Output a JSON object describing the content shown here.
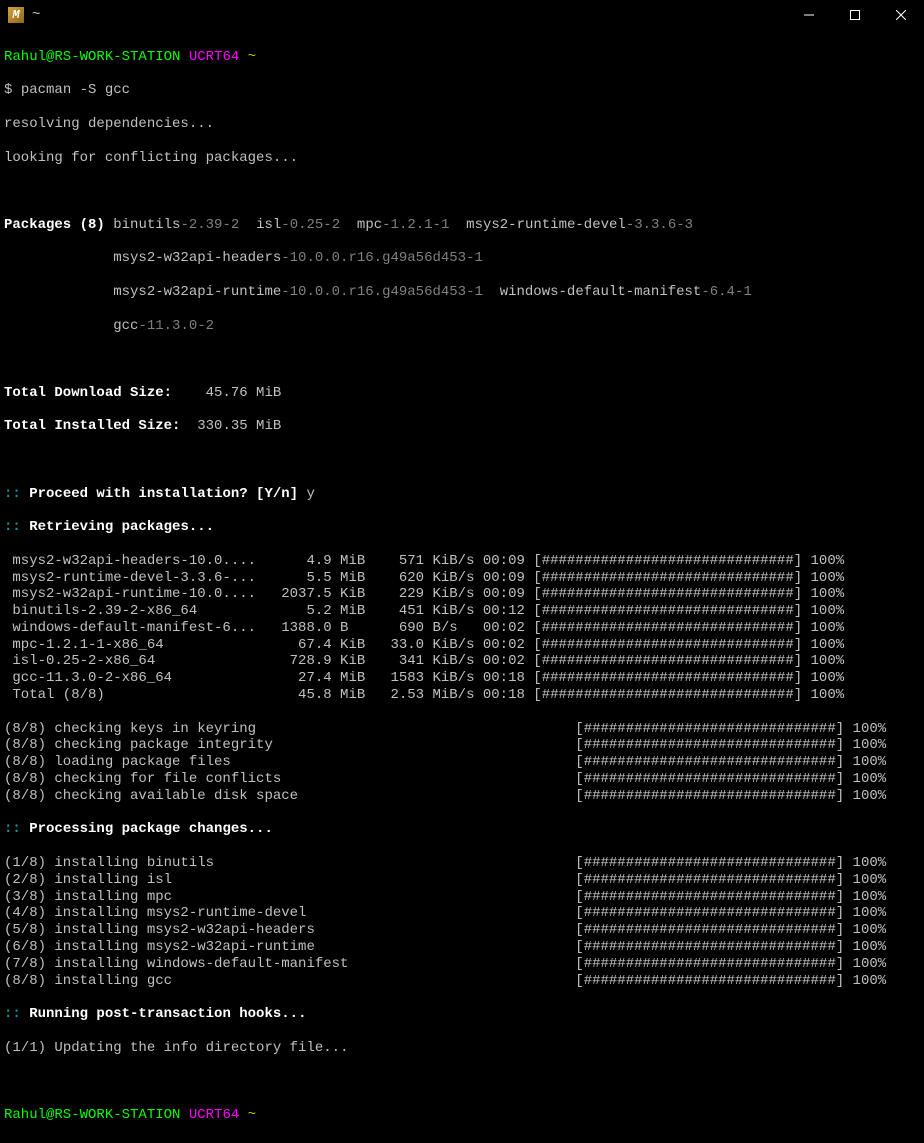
{
  "titlebar": {
    "title": "~"
  },
  "prompt": {
    "user_host": "Rahul@RS-WORK-STATION",
    "env": "UCRT64",
    "path": "~",
    "symbol": "$",
    "command": "pacman -S gcc"
  },
  "pre_lines": {
    "resolving": "resolving dependencies...",
    "conflict": "looking for conflicting packages..."
  },
  "packages_header": "Packages (8)",
  "packages": [
    {
      "name": "binutils",
      "ver": "-2.39-2"
    },
    {
      "name": "isl",
      "ver": "-0.25-2"
    },
    {
      "name": "mpc",
      "ver": "-1.2.1-1"
    },
    {
      "name": "msys2-runtime-devel",
      "ver": "-3.3.6-3"
    },
    {
      "name": "msys2-w32api-headers",
      "ver": "-10.0.0.r16.g49a56d453-1"
    },
    {
      "name": "msys2-w32api-runtime",
      "ver": "-10.0.0.r16.g49a56d453-1"
    },
    {
      "name": "windows-default-manifest",
      "ver": "-6.4-1"
    },
    {
      "name": "gcc",
      "ver": "-11.3.0-2"
    }
  ],
  "totals": {
    "download_label": "Total Download Size:",
    "download_val": "45.76 MiB",
    "installed_label": "Total Installed Size:",
    "installed_val": "330.35 MiB"
  },
  "proceed": {
    "marker": "::",
    "question": "Proceed with installation? [Y/n]",
    "answer": "y"
  },
  "retrieving_header": "Retrieving packages...",
  "downloads": [
    {
      "name": "msys2-w32api-headers-10.0....",
      "size": "4.9",
      "unit": "MiB",
      "rate": "571",
      "runit": "KiB/s",
      "time": "00:09",
      "pct": "100%"
    },
    {
      "name": "msys2-runtime-devel-3.3.6-...",
      "size": "5.5",
      "unit": "MiB",
      "rate": "620",
      "runit": "KiB/s",
      "time": "00:09",
      "pct": "100%"
    },
    {
      "name": "msys2-w32api-runtime-10.0....",
      "size": "2037.5",
      "unit": "KiB",
      "rate": "229",
      "runit": "KiB/s",
      "time": "00:09",
      "pct": "100%"
    },
    {
      "name": "binutils-2.39-2-x86_64",
      "size": "5.2",
      "unit": "MiB",
      "rate": "451",
      "runit": "KiB/s",
      "time": "00:12",
      "pct": "100%"
    },
    {
      "name": "windows-default-manifest-6...",
      "size": "1388.0",
      "unit": "B",
      "rate": "690",
      "runit": "B/s",
      "time": "00:02",
      "pct": "100%"
    },
    {
      "name": "mpc-1.2.1-1-x86_64",
      "size": "67.4",
      "unit": "KiB",
      "rate": "33.0",
      "runit": "KiB/s",
      "time": "00:02",
      "pct": "100%"
    },
    {
      "name": "isl-0.25-2-x86_64",
      "size": "728.9",
      "unit": "KiB",
      "rate": "341",
      "runit": "KiB/s",
      "time": "00:02",
      "pct": "100%"
    },
    {
      "name": "gcc-11.3.0-2-x86_64",
      "size": "27.4",
      "unit": "MiB",
      "rate": "1583",
      "runit": "KiB/s",
      "time": "00:18",
      "pct": "100%"
    },
    {
      "name": "Total (8/8)",
      "size": "45.8",
      "unit": "MiB",
      "rate": "2.53",
      "runit": "MiB/s",
      "time": "00:18",
      "pct": "100%"
    }
  ],
  "checks": [
    {
      "step": "(8/8)",
      "label": "checking keys in keyring",
      "pct": "100%"
    },
    {
      "step": "(8/8)",
      "label": "checking package integrity",
      "pct": "100%"
    },
    {
      "step": "(8/8)",
      "label": "loading package files",
      "pct": "100%"
    },
    {
      "step": "(8/8)",
      "label": "checking for file conflicts",
      "pct": "100%"
    },
    {
      "step": "(8/8)",
      "label": "checking available disk space",
      "pct": "100%"
    }
  ],
  "processing_header": "Processing package changes...",
  "installs": [
    {
      "step": "(1/8)",
      "label": "installing binutils",
      "pct": "100%"
    },
    {
      "step": "(2/8)",
      "label": "installing isl",
      "pct": "100%"
    },
    {
      "step": "(3/8)",
      "label": "installing mpc",
      "pct": "100%"
    },
    {
      "step": "(4/8)",
      "label": "installing msys2-runtime-devel",
      "pct": "100%"
    },
    {
      "step": "(5/8)",
      "label": "installing msys2-w32api-headers",
      "pct": "100%"
    },
    {
      "step": "(6/8)",
      "label": "installing msys2-w32api-runtime",
      "pct": "100%"
    },
    {
      "step": "(7/8)",
      "label": "installing windows-default-manifest",
      "pct": "100%"
    },
    {
      "step": "(8/8)",
      "label": "installing gcc",
      "pct": "100%"
    }
  ],
  "post_hooks_header": "Running post-transaction hooks...",
  "post_hook_line": {
    "step": "(1/1)",
    "label": "Updating the info directory file..."
  },
  "bar": "[##############################]"
}
